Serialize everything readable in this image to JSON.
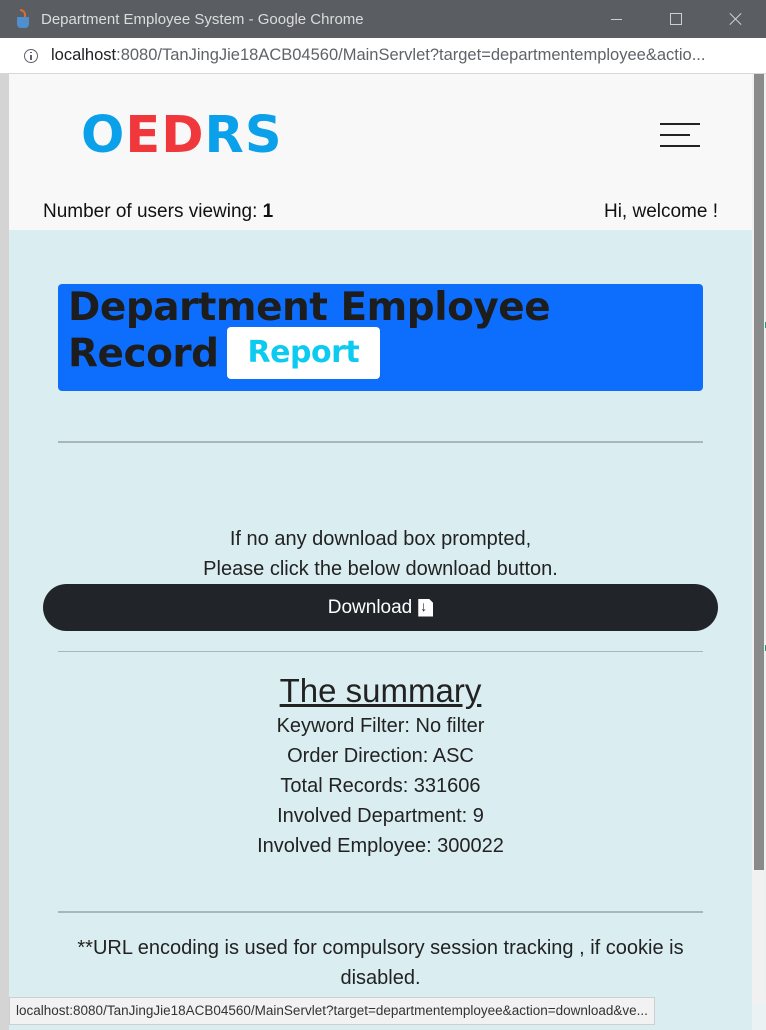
{
  "window": {
    "title": "Department Employee System - Google Chrome",
    "url_host": "localhost",
    "url_rest": ":8080/TanJingJie18ACB04560/MainServlet?target=departmentemployee&actio..."
  },
  "header": {
    "logo": {
      "o": "O",
      "e": "E",
      "d": "D",
      "r": "R",
      "s": "S"
    },
    "users_label": "Number of users viewing: ",
    "users_count": "1",
    "welcome": "Hi, welcome !"
  },
  "banner": {
    "title": "Department Employee Record",
    "badge": "Report"
  },
  "download": {
    "line1": "If no any download box prompted,",
    "line2": "Please click the below download button.",
    "button": "Download"
  },
  "summary": {
    "title": "The summary",
    "items": [
      "Keyword Filter: No filter",
      "Order Direction: ASC",
      "Total Records: 331606",
      "Involved Department: 9",
      "Involved Employee: 300022"
    ]
  },
  "footer": {
    "note": "**URL encoding is used for compulsory session tracking , if cookie is disabled."
  },
  "status_bar": {
    "url": "localhost:8080/TanJingJie18ACB04560/MainServlet?target=departmentemployee&action=download&ve..."
  },
  "colors": {
    "logo_blue": "#0aa0ea",
    "logo_red": "#f0373c",
    "banner_bg": "#0d6efd",
    "badge_text": "#0dcaf0",
    "page_bg": "#daedf1",
    "button_dark": "#212529"
  }
}
